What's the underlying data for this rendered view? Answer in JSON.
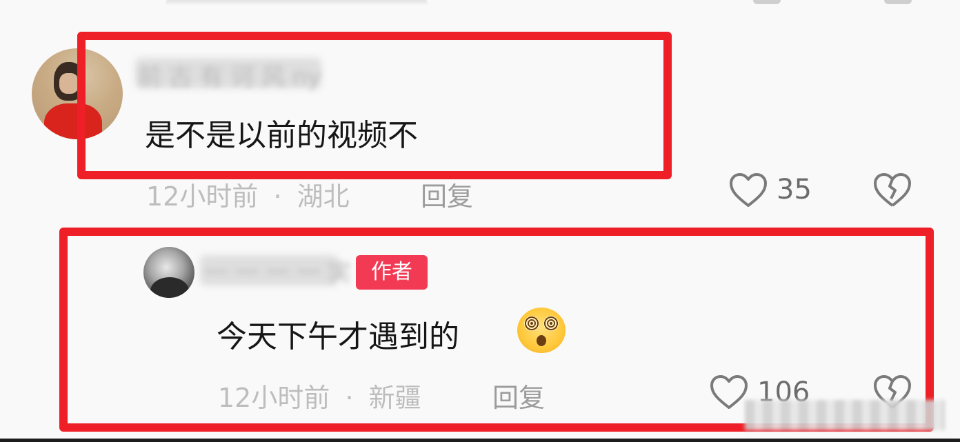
{
  "comments": [
    {
      "username": "前 古 有 诃 风 ny",
      "text": "是不是以前的视频不",
      "time": "12小时前",
      "separator": "·",
      "location": "湖北",
      "reply_label": "回复",
      "like_count": "35",
      "badge": ""
    },
    {
      "username": "一 一 一 一 実",
      "text": "今天下午才遇到的",
      "emoji": "dizzy-face-emoji",
      "time": "12小时前",
      "separator": "·",
      "location": "新疆",
      "reply_label": "回复",
      "like_count": "106",
      "badge": "作者"
    }
  ],
  "colors": {
    "highlight_border": "#ee1f26",
    "author_badge_bg": "#f23a55",
    "meta_text": "#bdbdbd",
    "like_icon": "#7a7a7a"
  },
  "icons": {
    "like": "heart-outline-icon",
    "dislike": "broken-heart-icon"
  }
}
